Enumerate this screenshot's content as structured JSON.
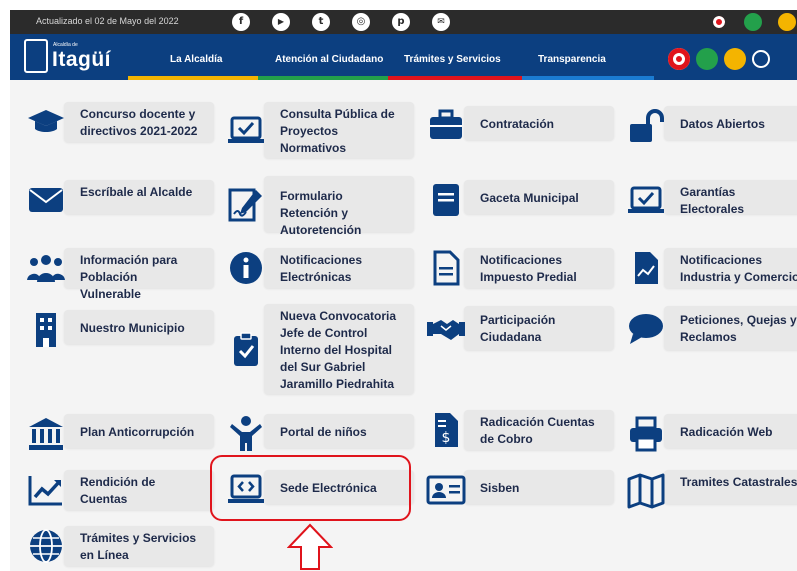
{
  "topbar": {
    "date": "Actualizado el 02 de Mayo del 2022",
    "social": [
      {
        "name": "facebook-icon",
        "glyph": "f"
      },
      {
        "name": "youtube-icon",
        "glyph": "▶"
      },
      {
        "name": "twitter-icon",
        "glyph": "t"
      },
      {
        "name": "instagram-icon",
        "glyph": "◎"
      },
      {
        "name": "pinterest-icon",
        "glyph": "p"
      },
      {
        "name": "mail-icon",
        "glyph": "✉"
      }
    ]
  },
  "header": {
    "logo_small": "Alcaldía de",
    "logo_big": "Itagüí",
    "nav": [
      "La Alcaldía",
      "Atención al Ciudadano",
      "Trámites y Servicios",
      "Transparencia"
    ],
    "stripe_colors": [
      "#f4b400",
      "#23a04b",
      "#e0141c",
      "#1b7bd1"
    ]
  },
  "tiles": [
    {
      "label": "Concurso docente y directivos 2021-2022",
      "icon": "graduation-cap-icon"
    },
    {
      "label": "Consulta Pública de Proyectos Normativos",
      "icon": "laptop-check-icon"
    },
    {
      "label": "Contratación",
      "icon": "briefcase-icon"
    },
    {
      "label": "Datos Abiertos",
      "icon": "unlock-icon"
    },
    {
      "label": "Escríbale al Alcalde",
      "icon": "envelope-icon"
    },
    {
      "label": "Formulario Retención y Autoretención",
      "icon": "signature-icon"
    },
    {
      "label": "Gaceta Municipal",
      "icon": "book-icon"
    },
    {
      "label": "Garantías Electorales",
      "icon": "laptop-check-icon"
    },
    {
      "label": "Información para Población Vulnerable",
      "icon": "people-icon"
    },
    {
      "label": "Notificaciones Electrónicas",
      "icon": "info-icon"
    },
    {
      "label": "Notificaciones Impuesto Predial",
      "icon": "document-icon"
    },
    {
      "label": "Notificaciones Industria y Comercio",
      "icon": "document-chart-icon"
    },
    {
      "label": "Nuestro Municipio",
      "icon": "building-icon"
    },
    {
      "label": "Nueva Convocatoria Jefe de Control Interno del Hospital del Sur Gabriel Jaramillo Piedrahita",
      "icon": "clipboard-check-icon"
    },
    {
      "label": "Participación Ciudadana",
      "icon": "handshake-icon"
    },
    {
      "label": "Peticiones, Quejas y Reclamos",
      "icon": "chat-icon"
    },
    {
      "label": "Plan Anticorrupción",
      "icon": "bank-icon"
    },
    {
      "label": "Portal de niños",
      "icon": "child-icon"
    },
    {
      "label": "Radicación Cuentas de Cobro",
      "icon": "invoice-icon"
    },
    {
      "label": "Radicación Web",
      "icon": "printer-icon"
    },
    {
      "label": "Rendición de Cuentas",
      "icon": "chart-line-icon"
    },
    {
      "label": "Sede Electrónica",
      "icon": "laptop-code-icon"
    },
    {
      "label": "Sisben",
      "icon": "id-card-icon"
    },
    {
      "label": "Tramites Catastrales",
      "icon": "map-icon"
    },
    {
      "label": "Trámites y Servicios en Línea",
      "icon": "globe-icon"
    }
  ],
  "colors": {
    "icon": "#0c3f80",
    "highlight": "#e0141c"
  }
}
